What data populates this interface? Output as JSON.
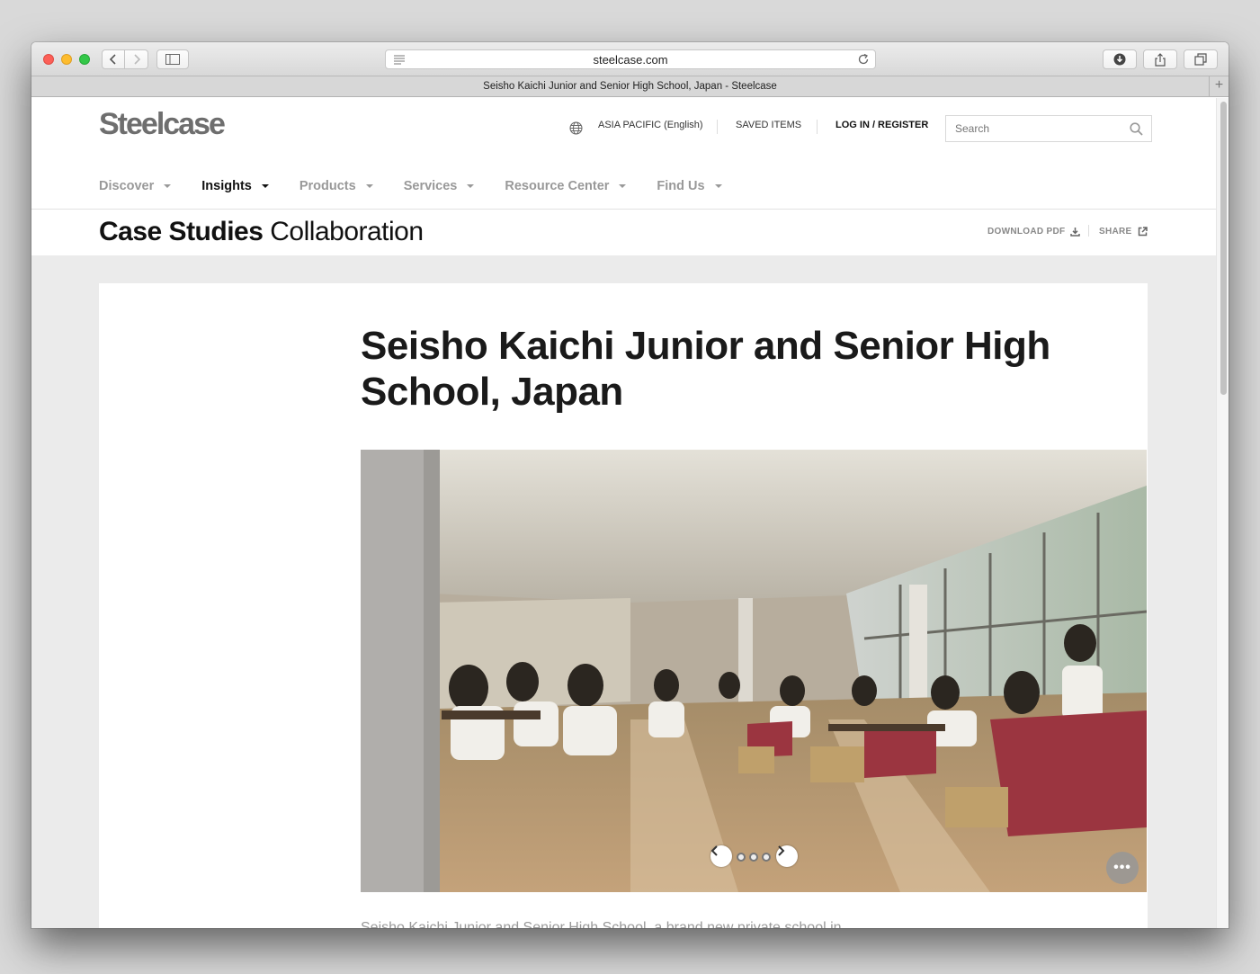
{
  "browser": {
    "url": "steelcase.com",
    "tab_title": "Seisho Kaichi Junior and Senior High School, Japan - Steelcase"
  },
  "site": {
    "logo": "Steelcase",
    "region": "ASIA PACIFIC (English)",
    "saved_items": "SAVED ITEMS",
    "login": "LOG IN / REGISTER",
    "search_placeholder": "Search"
  },
  "nav": {
    "items": [
      {
        "label": "Discover"
      },
      {
        "label": "Insights"
      },
      {
        "label": "Products"
      },
      {
        "label": "Services"
      },
      {
        "label": "Resource Center"
      },
      {
        "label": "Find Us"
      }
    ],
    "active": "Insights"
  },
  "page_header": {
    "section": "Case Studies",
    "category": "Collaboration",
    "download_pdf": "DOWNLOAD PDF",
    "share": "SHARE"
  },
  "article": {
    "title": "Seisho Kaichi Junior and Senior High School, Japan",
    "teaser": "Seisho Kaichi Junior and Senior High School, a brand new private school in",
    "carousel": {
      "slide_count": 3,
      "current_slide": 1,
      "more_label": "•••"
    }
  },
  "icons": {
    "globe": "globe-icon",
    "search": "search-icon",
    "download": "download-icon",
    "share": "external-link-icon"
  }
}
